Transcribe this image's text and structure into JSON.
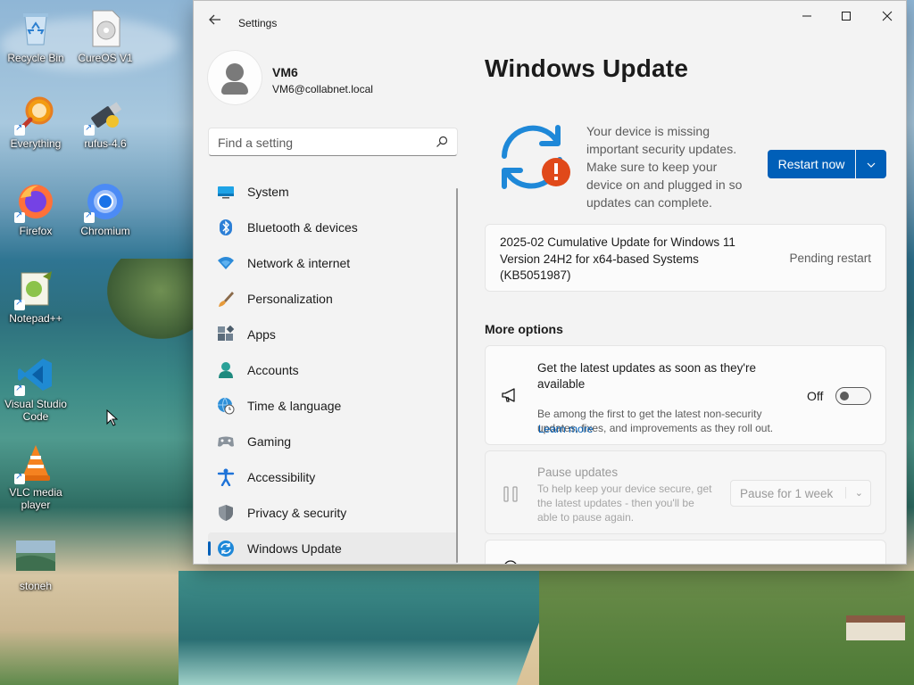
{
  "desktop": {
    "icons": [
      {
        "label": "Recycle Bin",
        "icon": "recycle-bin-icon"
      },
      {
        "label": "CureOS V1",
        "icon": "disc-file-icon"
      },
      {
        "label": "Everything",
        "icon": "everything-search-icon"
      },
      {
        "label": "rufus-4.6",
        "icon": "usb-drive-icon"
      },
      {
        "label": "Firefox",
        "icon": "firefox-icon"
      },
      {
        "label": "Chromium",
        "icon": "chromium-icon"
      },
      {
        "label": "Notepad++",
        "icon": "notepad-plus-plus-icon"
      },
      {
        "label": "Visual Studio Code",
        "label_line1": "Visual Studio",
        "label_line2": "Code",
        "icon": "vscode-icon"
      },
      {
        "label": "VLC media player",
        "label_line1": "VLC media",
        "label_line2": "player",
        "icon": "vlc-icon"
      },
      {
        "label": "stoneh",
        "icon": "image-thumbnail-icon"
      }
    ]
  },
  "window": {
    "title": "Settings",
    "controls": {
      "minimize": "minimize-icon",
      "maximize": "maximize-icon",
      "close": "close-icon"
    }
  },
  "profile": {
    "name": "VM6",
    "email": "VM6@collabnet.local"
  },
  "search": {
    "placeholder": "Find a setting"
  },
  "nav": {
    "items": [
      {
        "label": "System",
        "icon": "system-icon"
      },
      {
        "label": "Bluetooth & devices",
        "icon": "bluetooth-icon"
      },
      {
        "label": "Network & internet",
        "icon": "wifi-icon"
      },
      {
        "label": "Personalization",
        "icon": "brush-icon"
      },
      {
        "label": "Apps",
        "icon": "apps-icon"
      },
      {
        "label": "Accounts",
        "icon": "person-icon"
      },
      {
        "label": "Time & language",
        "icon": "globe-clock-icon"
      },
      {
        "label": "Gaming",
        "icon": "gamepad-icon"
      },
      {
        "label": "Accessibility",
        "icon": "accessibility-icon"
      },
      {
        "label": "Privacy & security",
        "icon": "shield-icon"
      },
      {
        "label": "Windows Update",
        "icon": "windows-update-icon",
        "active": true
      }
    ]
  },
  "main": {
    "title": "Windows Update",
    "status_message": "Your device is missing important security updates. Make sure to keep your device on and plugged in so updates can complete.",
    "restart_button": "Restart now",
    "update": {
      "name": "2025-02 Cumulative Update for Windows 11 Version 24H2 for x64-based Systems (KB5051987)",
      "status": "Pending restart"
    },
    "more_options_title": "More options",
    "latest_updates": {
      "title": "Get the latest updates as soon as they're available",
      "description": "Be among the first to get the latest non-security updates, fixes, and improvements as they roll out.",
      "link": "Learn more",
      "toggle_label": "Off",
      "toggle_on": false
    },
    "pause_updates": {
      "title": "Pause updates",
      "description": "To help keep your device secure, get the latest updates - then you'll be able to pause again.",
      "selected": "Pause for 1 week"
    }
  },
  "colors": {
    "accent": "#005fb8",
    "update_icon_blue": "#1e88d8",
    "warning_red": "#e0491a"
  }
}
